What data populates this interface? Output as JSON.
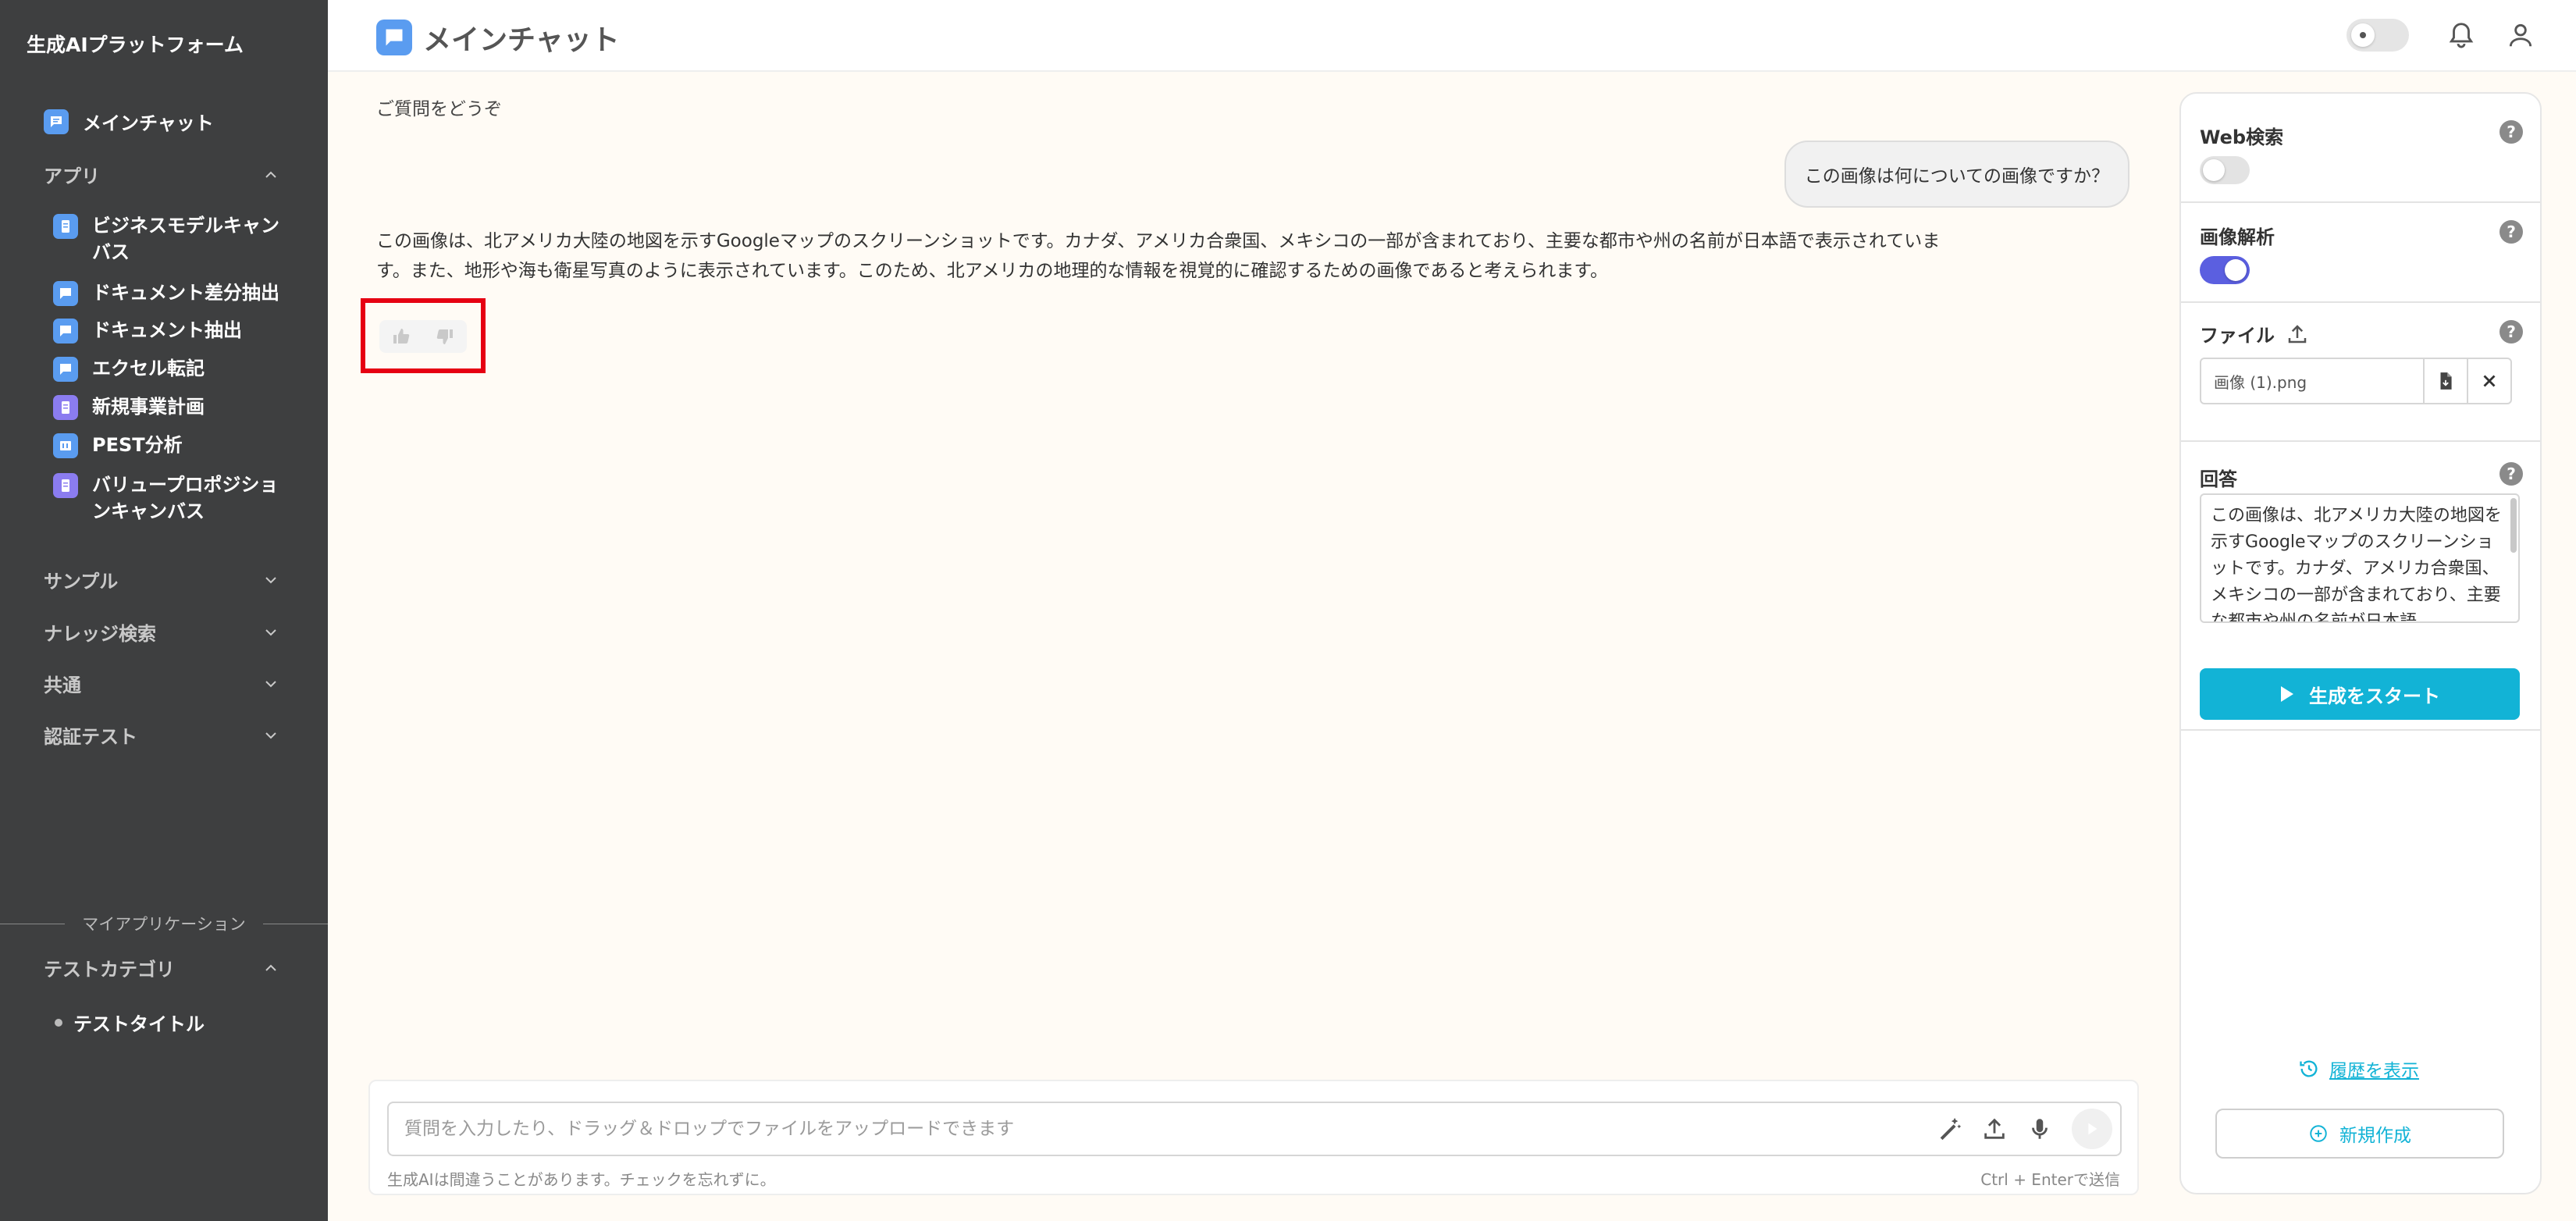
{
  "sidebar": {
    "brand": "生成AIプラットフォーム",
    "main_item": "メインチャット",
    "apps_group": "アプリ",
    "apps": [
      {
        "label": "ビジネスモデルキャンバス",
        "icon": "document-icon"
      },
      {
        "label": "ドキュメント差分抽出",
        "icon": "chat-icon"
      },
      {
        "label": "ドキュメント抽出",
        "icon": "chat-icon"
      },
      {
        "label": "エクセル転記",
        "icon": "chat-icon"
      },
      {
        "label": "新規事業計画",
        "icon": "document-icon"
      },
      {
        "label": "PEST分析",
        "icon": "grid-icon"
      },
      {
        "label": "バリュープロポジションキャンバス",
        "icon": "document-icon"
      }
    ],
    "groups": [
      "サンプル",
      "ナレッジ検索",
      "共通",
      "認証テスト"
    ],
    "my_apps_label": "マイアプリケーション",
    "test_category": "テストカテゴリ",
    "test_title": "テストタイトル"
  },
  "header": {
    "title": "メインチャット"
  },
  "chat": {
    "prompt_label": "ご質問をどうぞ",
    "user_message": "この画像は何についての画像ですか？",
    "answer_line1": "この画像は、北アメリカ大陸の地図を示すGoogleマップのスクリーンショットです。カナダ、アメリカ合衆国、メキシコの一部が含まれており、主要な都市や州の名前が日本語で表示されていま",
    "answer_line2": "す。また、地形や海も衛星写真のように表示されています。このため、北アメリカの地理的な情報を視覚的に確認するための画像であると考えられます。"
  },
  "input": {
    "placeholder": "質問を入力したり、ドラッグ＆ドロップでファイルをアップロードできます",
    "note": "生成AIは間違うことがあります。チェックを忘れずに。",
    "hint": "Ctrl + Enterで送信"
  },
  "panel": {
    "web_search": "Web検索",
    "web_search_enabled": false,
    "image_analysis": "画像解析",
    "image_analysis_enabled": true,
    "file_label": "ファイル",
    "file_name": "画像 (1).png",
    "answer_label": "回答",
    "answer_text": "この画像は、北アメリカ大陸の地図を示すGoogleマップのスクリーンショットです。カナダ、アメリカ合衆国、メキシコの一部が含まれており、主要な都市や州の名前が日本語",
    "start_button": "生成をスタート",
    "history_link": "履歴を表示",
    "new_button": "新規作成"
  },
  "colors": {
    "sidebar_bg": "#3e3f40",
    "accent": "#12b3d6",
    "toggle_on": "#5b5fe0",
    "highlight": "#e60012"
  }
}
